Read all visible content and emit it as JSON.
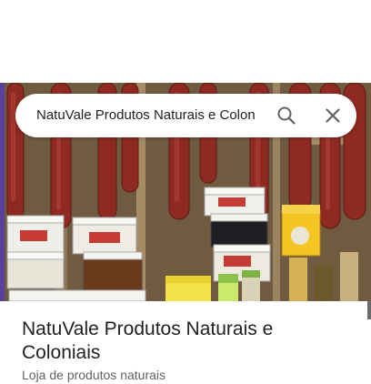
{
  "search": {
    "query": "NatuVale Produtos Naturais e Colon"
  },
  "place": {
    "name": "NatuVale Produtos Naturais e Coloniais",
    "category": "Loja de produtos naturais"
  },
  "icons": {
    "search": "search-icon",
    "close": "close-icon"
  },
  "colors": {
    "text_primary": "#202124",
    "text_secondary": "#5f6368",
    "icon": "#5f6368"
  }
}
